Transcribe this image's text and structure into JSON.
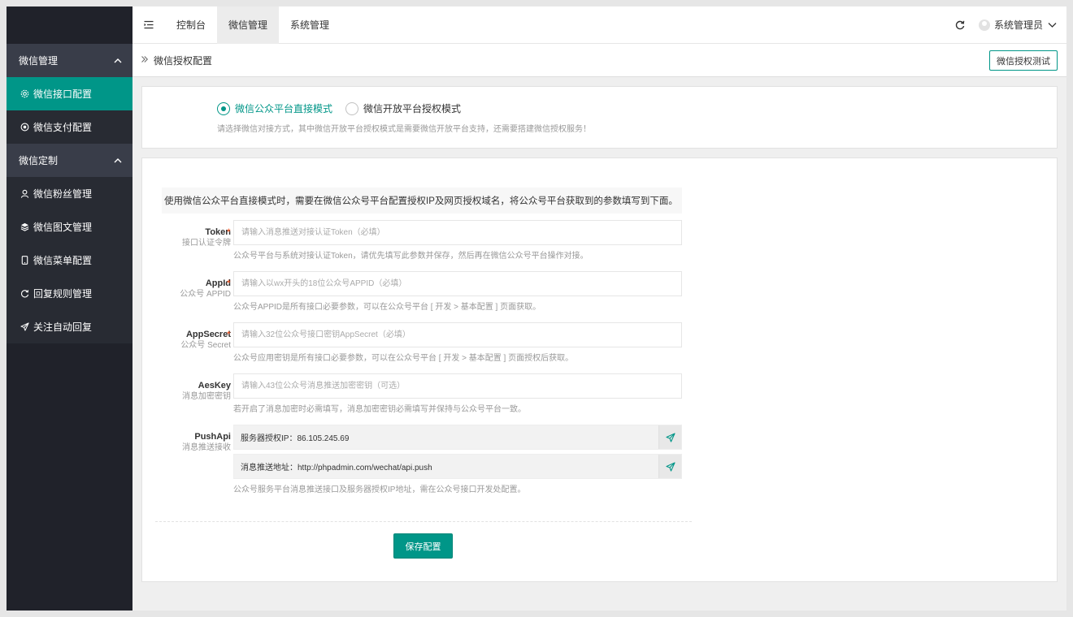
{
  "sidebar": {
    "groups": [
      {
        "label": "微信管理",
        "items": [
          {
            "label": "微信接口配置",
            "icon": "gear-icon",
            "active": true
          },
          {
            "label": "微信支付配置",
            "icon": "circle-dot-icon"
          }
        ]
      },
      {
        "label": "微信定制",
        "items": [
          {
            "label": "微信粉丝管理",
            "icon": "user-icon"
          },
          {
            "label": "微信图文管理",
            "icon": "layers-icon"
          },
          {
            "label": "微信菜单配置",
            "icon": "phone-icon"
          },
          {
            "label": "回复规则管理",
            "icon": "sync-icon"
          },
          {
            "label": "关注自动回复",
            "icon": "send-icon"
          }
        ]
      }
    ]
  },
  "header": {
    "tabs": [
      {
        "label": "控制台"
      },
      {
        "label": "微信管理",
        "active": true
      },
      {
        "label": "系统管理"
      }
    ],
    "user_name": "系统管理员"
  },
  "breadcrumb": {
    "title": "微信授权配置",
    "test_button": "微信授权测试"
  },
  "mode": {
    "options": [
      {
        "label": "微信公众平台直接模式",
        "checked": true
      },
      {
        "label": "微信开放平台授权模式",
        "checked": false
      }
    ],
    "help": "请选择微信对接方式，其中微信开放平台授权模式是需要微信开放平台支持，还需要搭建微信授权服务！"
  },
  "notice": "使用微信公众平台直接模式时，需要在微信公众号平台配置授权IP及网页授权域名，将公众号平台获取到的参数填写到下面。",
  "fields": {
    "token": {
      "label": "Token",
      "sub": "接口认证令牌",
      "required": "*",
      "placeholder": "请输入消息推送对接认证Token（必填）",
      "help": "公众号平台与系统对接认证Token，请优先填写此参数并保存，然后再在微信公众号平台操作对接。"
    },
    "appid": {
      "label": "AppId",
      "sub": "公众号 APPID",
      "required": "*",
      "placeholder": "请输入以wx开头的18位公众号APPID（必填）",
      "help": "公众号APPID是所有接口必要参数，可以在公众号平台 [ 开发 > 基本配置 ] 页面获取。"
    },
    "appsecret": {
      "label": "AppSecret",
      "sub": "公众号 Secret",
      "required": "*",
      "placeholder": "请输入32位公众号接口密钥AppSecret（必填）",
      "help": "公众号应用密钥是所有接口必要参数，可以在公众号平台 [ 开发 > 基本配置 ] 页面授权后获取。"
    },
    "aeskey": {
      "label": "AesKey",
      "sub": "消息加密密钥",
      "placeholder": "请输入43位公众号消息推送加密密钥（可选）",
      "help": "若开启了消息加密时必需填写，消息加密密钥必需填写并保持与公众号平台一致。"
    },
    "pushapi": {
      "label": "PushApi",
      "sub": "消息推送接收",
      "ip_line": "服务器授权IP：86.105.245.69",
      "url_line": "消息推送地址：http://phpadmin.com/wechat/api.push",
      "help": "公众号服务平台消息推送接口及服务器授权IP地址，需在公众号接口开发处配置。"
    }
  },
  "save_button": "保存配置",
  "colors": {
    "accent": "#009688",
    "sidebar_bg": "#20222a",
    "required": "#ff5722"
  }
}
